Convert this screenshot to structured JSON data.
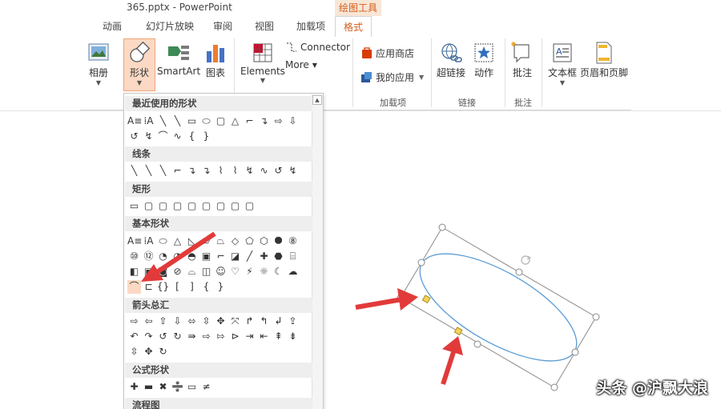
{
  "window": {
    "title": "365.pptx - PowerPoint"
  },
  "contextual_tab": "绘图工具",
  "tabs": [
    "动画",
    "幻灯片放映",
    "审阅",
    "视图",
    "加载项",
    "格式"
  ],
  "ribbon": {
    "album": "相册",
    "shapes": "形状",
    "smartart": "SmartArt",
    "chart": "图表",
    "elements": "Elements",
    "connector": "Connector",
    "more": "More",
    "app_store": "应用商店",
    "my_apps": "我的应用",
    "hyperlink": "超链接",
    "action": "动作",
    "comment": "批注",
    "textbox": "文本框",
    "header_footer": "页眉和页脚",
    "groups": {
      "addins": "加载项",
      "links": "链接",
      "comments": "批注"
    }
  },
  "dropdown": {
    "sections": [
      "最近使用的形状",
      "线条",
      "矩形",
      "基本形状",
      "箭头总汇",
      "公式形状",
      "流程图"
    ],
    "row_icons": {
      "recent1": [
        "A≡",
        "⁞A",
        "╲",
        "╲",
        "▭",
        "⬭",
        "▢",
        "△",
        "⌐",
        "↴",
        "⇨",
        "⇩"
      ],
      "recent2": [
        "↺",
        "↯",
        "⌒",
        "∿",
        "{",
        "}"
      ],
      "lines": [
        "╲",
        "╲",
        "╲",
        "⌐",
        "↴",
        "↴",
        "⌇",
        "⌇",
        "↯",
        "∿",
        "↺",
        "↯"
      ],
      "rects": [
        "▭",
        "▢",
        "▢",
        "▢",
        "▢",
        "▢",
        "▢",
        "▢",
        "▢"
      ],
      "basic1": [
        "A≡",
        "⁞A",
        "⬭",
        "△",
        "◺",
        "▱",
        "⏢",
        "◇",
        "⬠",
        "⬡",
        "⯃",
        "⑧"
      ],
      "basic2": [
        "⑩",
        "⑫",
        "◔",
        "◑",
        "◓",
        "▣",
        "⌐",
        "◪",
        "╱",
        "✚",
        "⬣",
        "⌸"
      ],
      "basic3": [
        "◧",
        "▣",
        "◙",
        "⊘",
        "⌓",
        "◫",
        "☺",
        "♡",
        "⚡",
        "☼",
        "☾",
        "☁"
      ],
      "basic4": [
        "⌒",
        "⊏",
        "{}",
        "[",
        "]",
        "{",
        "}"
      ],
      "arrows1": [
        "⇨",
        "⇦",
        "⇧",
        "⇩",
        "⬄",
        "⇳",
        "✥",
        "⤧",
        "↱",
        "↰",
        "↲",
        "⇪"
      ],
      "arrows2": [
        "↶",
        "↷",
        "↺",
        "↻",
        "⇛",
        "⇨",
        "⇰",
        "⊳",
        "⇥",
        "⇤",
        "⇞",
        "⇟"
      ],
      "arrows3": [
        "⇳",
        "✥",
        "↻"
      ],
      "equation": [
        "✚",
        "▬",
        "✖",
        "➗",
        "▭",
        "≠"
      ]
    }
  },
  "watermark": "头条 @沪飘大浪",
  "colors": {
    "accent": "#d45e1a",
    "ellipse": "#5b9bd5",
    "arrow": "#e23a3a",
    "handle": "#f2d35a"
  }
}
